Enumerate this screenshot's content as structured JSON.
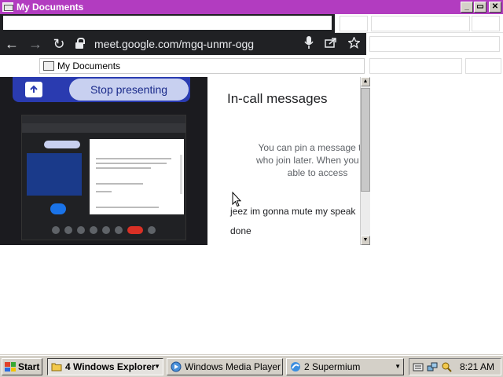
{
  "window": {
    "title": "My Documents",
    "title_bar_color": "#b23cc0",
    "buttons": {
      "minimize": "_",
      "restore": "▭",
      "close": "✕"
    }
  },
  "browser": {
    "url": "meet.google.com/mgq-unmr-ogg",
    "nav": {
      "back": "←",
      "forward": "→",
      "reload": "↻"
    },
    "icons": {
      "mic": "mic-icon",
      "share": "share-icon",
      "bookmark": "star-icon"
    }
  },
  "address_bar": {
    "value": "My Documents"
  },
  "presenting": {
    "stop_label": "Stop presenting",
    "accent": "#2a3bb0"
  },
  "messages_panel": {
    "heading": "In-call messages",
    "info_line1": "You can pin a message to m",
    "info_line2": "who join later. When you leav",
    "info_line3": "able to access",
    "message_1": "jeez im gonna mute my speak",
    "message_2": "done"
  },
  "taskbar": {
    "start_label": "Start",
    "tasks": [
      {
        "label": "4 Windows Explorer"
      },
      {
        "label": "Windows Media Player"
      },
      {
        "label": "2 Supermium"
      }
    ],
    "clock": "8:21 AM"
  }
}
